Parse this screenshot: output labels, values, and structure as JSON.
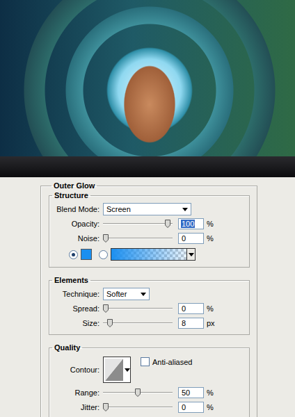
{
  "panel": {
    "title": "Outer Glow"
  },
  "sections": [
    {
      "title": "Structure",
      "rows": [
        {
          "kind": "select",
          "label": "Blend Mode:",
          "value": "Screen"
        },
        {
          "kind": "slider",
          "label": "Opacity:",
          "value": "100",
          "unit": "%",
          "level": 0.97,
          "focused": true
        },
        {
          "kind": "slider",
          "label": "Noise:",
          "value": "0",
          "unit": "%",
          "level": 0,
          "focused": false
        },
        {
          "kind": "fill",
          "options": [
            {
              "kind": "color",
              "selected": true,
              "color": "#1b8ff0"
            },
            {
              "kind": "gradient",
              "selected": false,
              "color": "#1b8ff0"
            }
          ]
        }
      ]
    },
    {
      "title": "Elements",
      "rows": [
        {
          "kind": "select",
          "label": "Technique:",
          "value": "Softer"
        },
        {
          "kind": "slider",
          "label": "Spread:",
          "value": "0",
          "unit": "%",
          "level": 0,
          "focused": false
        },
        {
          "kind": "slider",
          "label": "Size:",
          "value": "8",
          "unit": "px",
          "level": 0.06,
          "focused": false
        }
      ]
    },
    {
      "title": "Quality",
      "rows": [
        {
          "kind": "contour",
          "label": "Contour:",
          "checkbox": "Anti-aliased",
          "checked": false
        },
        {
          "kind": "slider",
          "label": "Range:",
          "value": "50",
          "unit": "%",
          "level": 0.5,
          "focused": false
        },
        {
          "kind": "slider",
          "label": "Jitter:",
          "value": "0",
          "unit": "%",
          "level": 0,
          "focused": false
        }
      ]
    }
  ]
}
